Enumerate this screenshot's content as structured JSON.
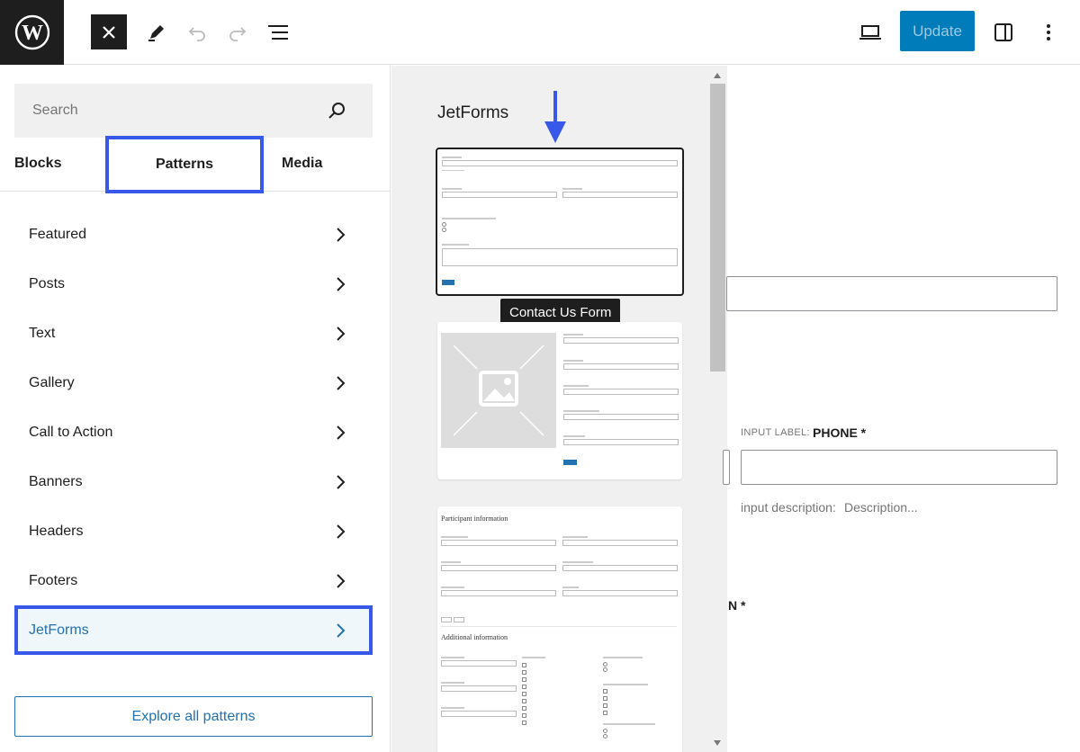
{
  "toolbar": {
    "logo": "wordpress-icon",
    "close": "close-icon",
    "tools": "pencil-icon",
    "undo": "undo-icon",
    "redo": "redo-icon",
    "list_view": "list-view-icon",
    "preview": "laptop-icon",
    "update_label": "Update",
    "settings": "sidebar-toggle-icon",
    "options": "more-vertical-icon"
  },
  "inserter": {
    "search_placeholder": "Search",
    "tabs": [
      {
        "label": "Blocks"
      },
      {
        "label": "Patterns"
      },
      {
        "label": "Media"
      }
    ],
    "categories": [
      {
        "label": "Featured"
      },
      {
        "label": "Posts"
      },
      {
        "label": "Text"
      },
      {
        "label": "Gallery"
      },
      {
        "label": "Call to Action"
      },
      {
        "label": "Banners"
      },
      {
        "label": "Headers"
      },
      {
        "label": "Footers"
      },
      {
        "label": "JetForms"
      }
    ],
    "explore_label": "Explore all patterns"
  },
  "patterns_panel": {
    "title": "JetForms",
    "tooltip": "Contact Us Form",
    "card3_heading1": "Participant information",
    "card3_heading2": "Additional information"
  },
  "editor": {
    "input_label_prefix": "INPUT LABEL:",
    "input_label_value": "PHONE *",
    "desc_label": "input description:",
    "desc_placeholder": "Description...",
    "fragment": "N *"
  },
  "colors": {
    "accent": "#007cba",
    "highlight": "#3858e9",
    "dark": "#1e1e1e"
  }
}
